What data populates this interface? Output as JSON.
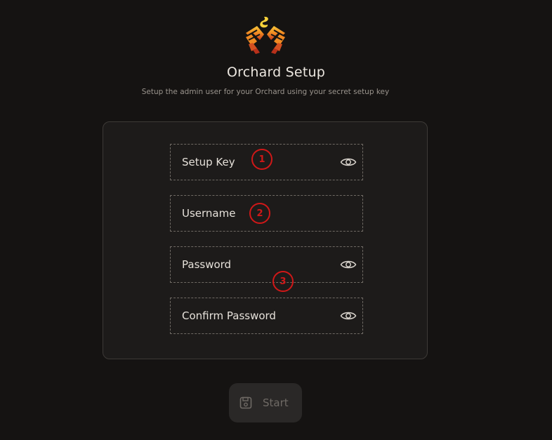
{
  "header": {
    "title": "Orchard Setup",
    "subtitle": "Setup the admin user for your Orchard using your secret setup key"
  },
  "form": {
    "fields": [
      {
        "label": "Setup Key",
        "has_visibility_toggle": true,
        "icon": "eye-icon"
      },
      {
        "label": "Username",
        "has_visibility_toggle": false
      },
      {
        "label": "Password",
        "has_visibility_toggle": true,
        "icon": "eye-icon"
      },
      {
        "label": "Confirm Password",
        "has_visibility_toggle": true,
        "icon": "eye-icon"
      }
    ]
  },
  "annotations": [
    {
      "number": "1"
    },
    {
      "number": "2"
    },
    {
      "number": "3"
    }
  ],
  "actions": {
    "start_label": "Start",
    "start_icon": "save-icon",
    "start_disabled": true
  },
  "colors": {
    "background": "#151312",
    "card": "#1d1b1a",
    "accent_red": "#d01818",
    "logo_orange": "#f0a020"
  }
}
